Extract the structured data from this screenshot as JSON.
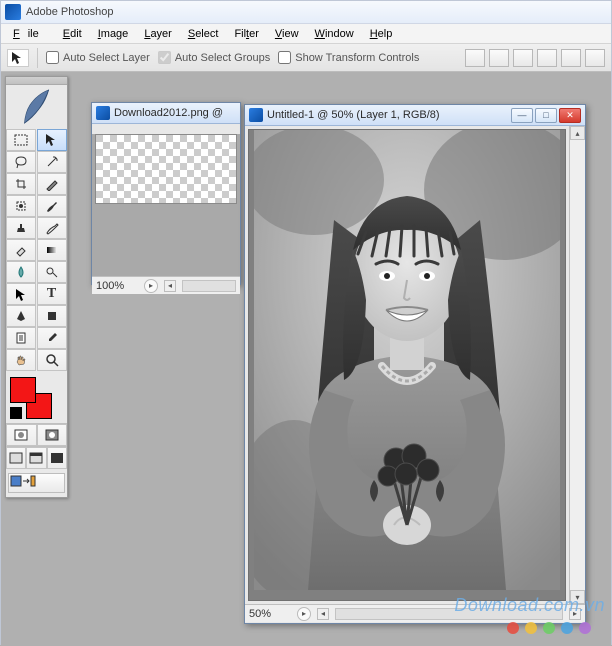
{
  "app": {
    "title": "Adobe Photoshop"
  },
  "menu": {
    "file": "File",
    "edit": "Edit",
    "image": "Image",
    "layer": "Layer",
    "select": "Select",
    "filter": "Filter",
    "view": "View",
    "window": "Window",
    "help": "Help"
  },
  "options": {
    "auto_select_layer": "Auto Select Layer",
    "auto_select_groups": "Auto Select Groups",
    "show_transform_controls": "Show Transform Controls"
  },
  "doc1": {
    "title": "Download2012.png @",
    "zoom": "100%"
  },
  "doc2": {
    "title": "Untitled-1 @ 50% (Layer 1, RGB/8)",
    "zoom": "50%"
  },
  "colors": {
    "foreground": "#f31616",
    "background": "#f31616",
    "dots": [
      "#e74a3c",
      "#f3c13a",
      "#6bcf63",
      "#4aa3e0",
      "#b06fd8"
    ]
  },
  "watermark": "Download.com.vn"
}
